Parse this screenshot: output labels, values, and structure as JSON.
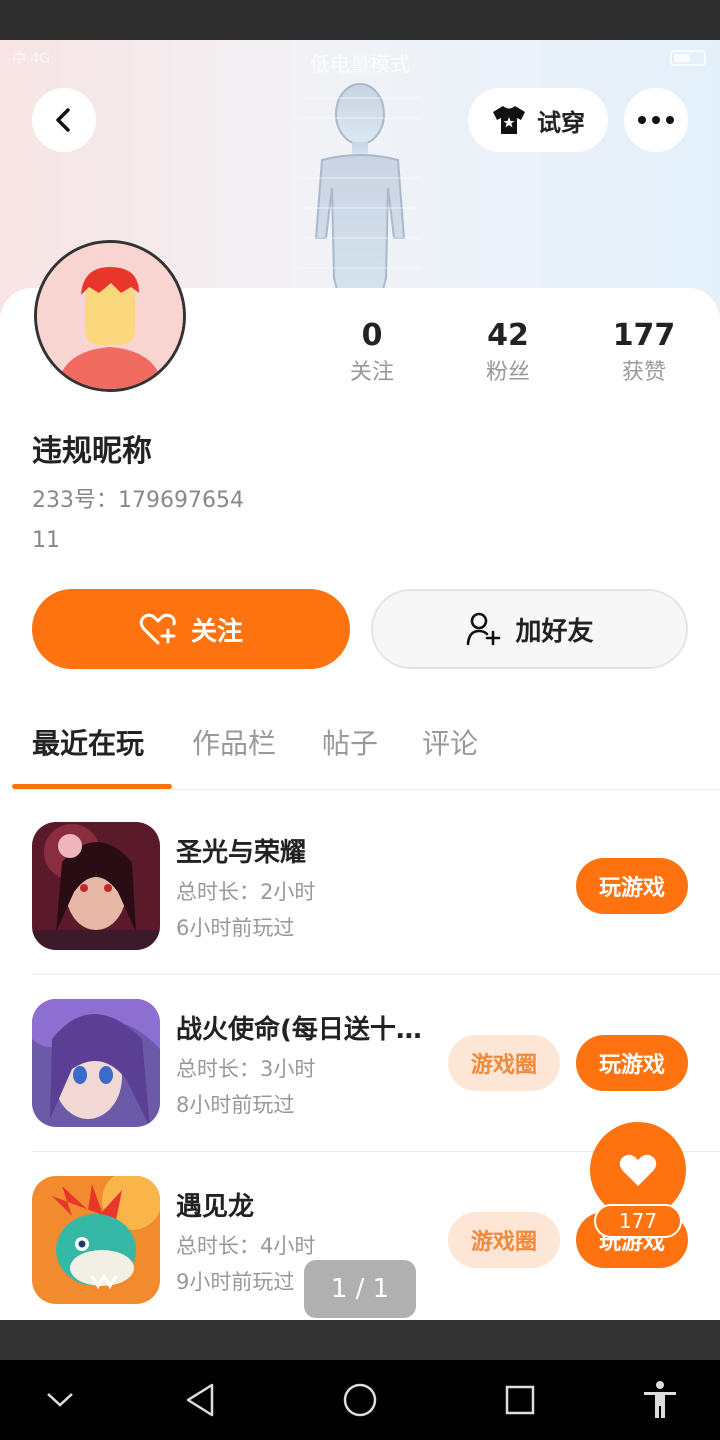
{
  "status": {
    "left_text": "中 4G",
    "mode_text": "低电量模式"
  },
  "header": {
    "tryon_label": "试穿"
  },
  "stats": [
    {
      "value": "0",
      "label": "关注"
    },
    {
      "value": "42",
      "label": "粉丝"
    },
    {
      "value": "177",
      "label": "获赞"
    }
  ],
  "profile": {
    "nickname": "违规昵称",
    "uid": "233号：179697654",
    "bio": "11"
  },
  "actions": {
    "follow_label": "关注",
    "add_friend_label": "加好友"
  },
  "tabs": [
    {
      "label": "最近在玩",
      "active": true
    },
    {
      "label": "作品栏",
      "active": false
    },
    {
      "label": "帖子",
      "active": false
    },
    {
      "label": "评论",
      "active": false
    }
  ],
  "games": [
    {
      "name": "圣光与荣耀",
      "duration": "总时长：2小时",
      "last_played": "6小时前玩过",
      "play_label": "玩游戏",
      "circle_label": ""
    },
    {
      "name": "战火使命(每日送十…",
      "duration": "总时长：3小时",
      "last_played": "8小时前玩过",
      "play_label": "玩游戏",
      "circle_label": "游戏圈"
    },
    {
      "name": "遇见龙",
      "duration": "总时长：4小时",
      "last_played": "9小时前玩过",
      "play_label": "玩游戏",
      "circle_label": "游戏圈"
    }
  ],
  "like_fab": {
    "count": "177"
  },
  "pager": {
    "text": "1 / 1"
  },
  "colors": {
    "accent": "#ff7210",
    "circle_bg": "#fde6d6",
    "circle_text": "#f0893c"
  },
  "icons": [
    "back-icon",
    "tshirt-icon",
    "more-icon",
    "heart-plus-icon",
    "user-plus-icon",
    "heart-icon",
    "nav-down-icon",
    "nav-back-icon",
    "nav-home-icon",
    "nav-recents-icon",
    "accessibility-icon"
  ]
}
